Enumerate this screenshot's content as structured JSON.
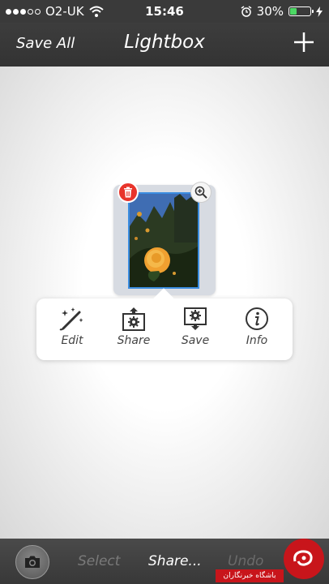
{
  "status_bar": {
    "carrier": "O2-UK",
    "time": "15:46",
    "battery_percent": "30%",
    "battery_level": 0.3
  },
  "nav": {
    "left_button": "Save All",
    "title": "Lightbox"
  },
  "popup": {
    "actions": [
      {
        "label": "Edit",
        "icon": "magic-wand-icon"
      },
      {
        "label": "Share",
        "icon": "share-box-icon"
      },
      {
        "label": "Save",
        "icon": "save-box-icon"
      },
      {
        "label": "Info",
        "icon": "info-icon"
      }
    ]
  },
  "toolbar": {
    "select": "Select",
    "share": "Share...",
    "undo": "Undo"
  },
  "watermark": {
    "text": "باشگاه خبرنگاران"
  },
  "colors": {
    "accent": "#3b8de0",
    "delete": "#e8342b",
    "battery": "#4cd964",
    "watermark": "#c8151b"
  }
}
